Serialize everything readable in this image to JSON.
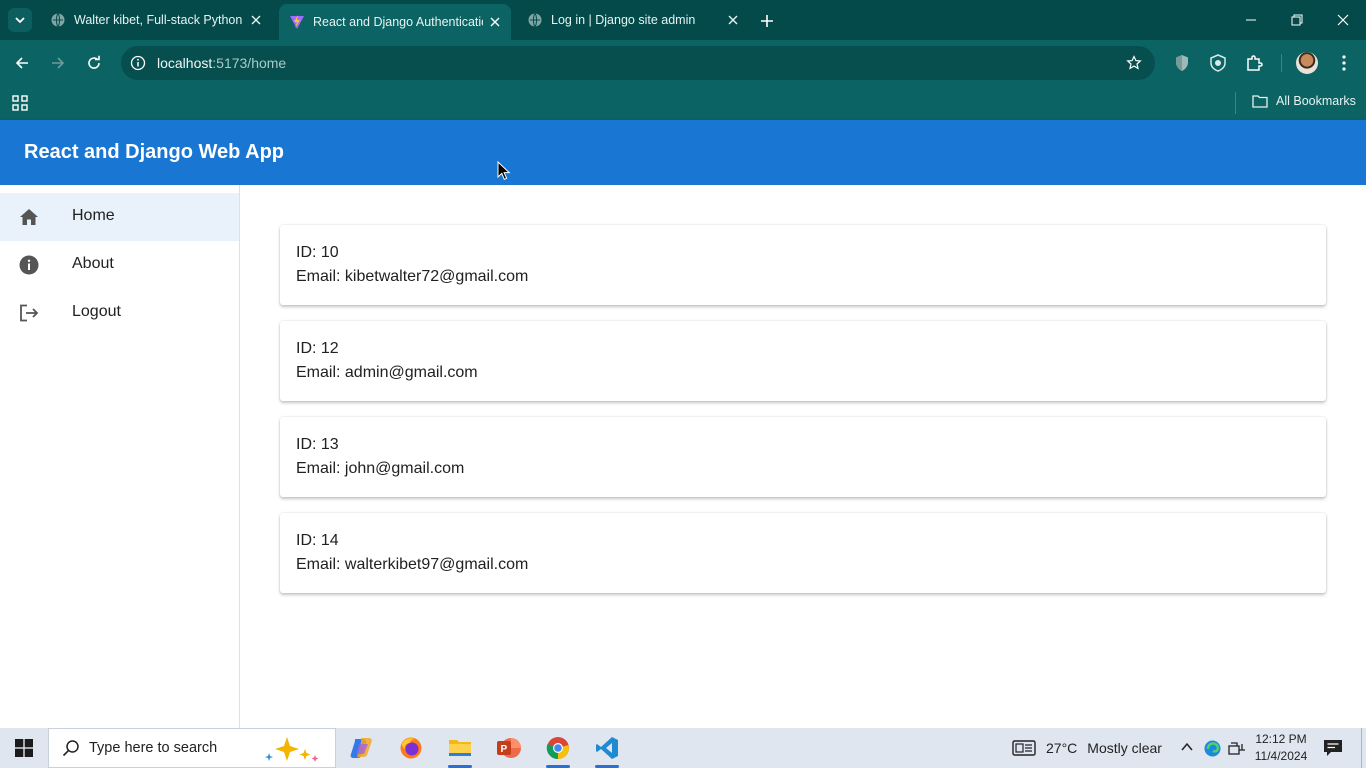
{
  "browser": {
    "tabs": [
      {
        "title": "Walter kibet, Full-stack Python a",
        "active": false
      },
      {
        "title": "React and Django Authenticatio",
        "active": true
      },
      {
        "title": "Log in | Django site admin",
        "active": false
      }
    ],
    "url_host": "localhost",
    "url_path": ":5173/home",
    "bookmarks_label": "All Bookmarks"
  },
  "app": {
    "title": "React and Django Web App",
    "nav": [
      {
        "label": "Home",
        "icon": "home-icon",
        "selected": true
      },
      {
        "label": "About",
        "icon": "info-icon",
        "selected": false
      },
      {
        "label": "Logout",
        "icon": "logout-icon",
        "selected": false
      }
    ],
    "users": [
      {
        "id_line": "ID: 10",
        "email_line": "Email: kibetwalter72@gmail.com"
      },
      {
        "id_line": "ID: 12",
        "email_line": "Email: admin@gmail.com"
      },
      {
        "id_line": "ID: 13",
        "email_line": "Email: john@gmail.com"
      },
      {
        "id_line": "ID: 14",
        "email_line": "Email: walterkibet97@gmail.com"
      }
    ],
    "colors": {
      "appbar": "#1976d2",
      "selected_nav": "#e9f1fb"
    }
  },
  "taskbar": {
    "search_placeholder": "Type here to search",
    "temperature": "27°C",
    "condition": "Mostly clear",
    "time": "12:12 PM",
    "date": "11/4/2024"
  }
}
